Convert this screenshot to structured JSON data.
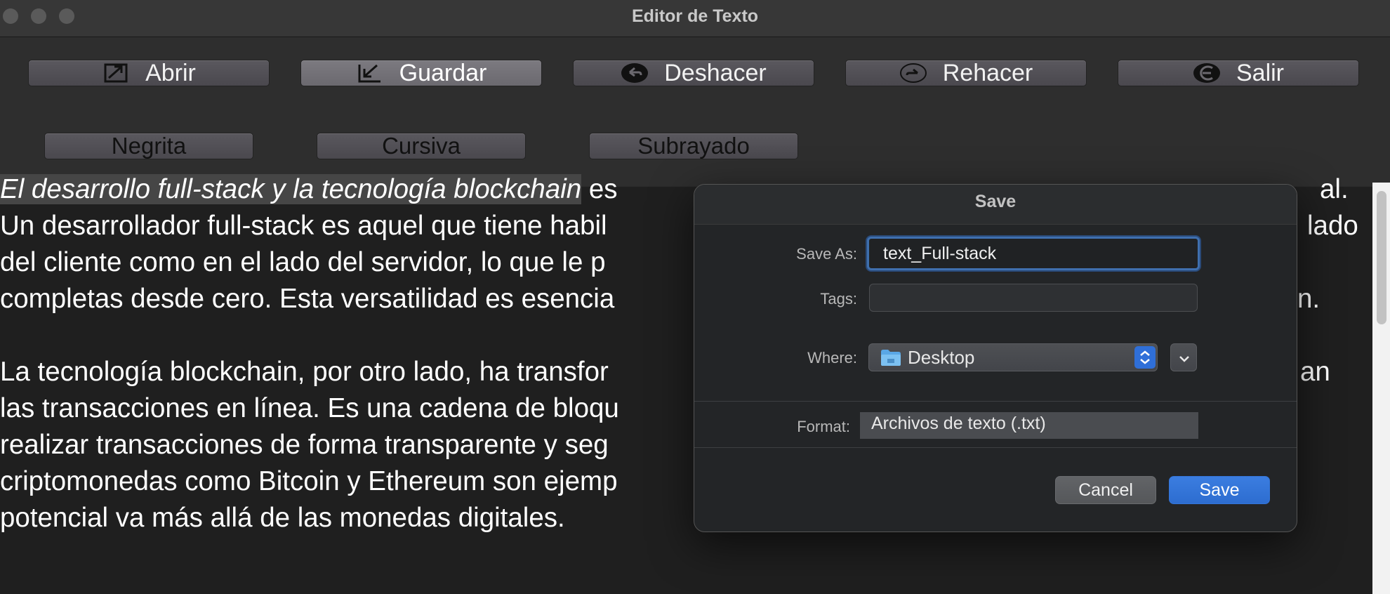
{
  "window": {
    "title": "Editor de Texto"
  },
  "toolbar": {
    "row1": [
      {
        "label": "Abrir",
        "icon": "open-external-icon"
      },
      {
        "label": "Guardar",
        "icon": "save-arrow-icon"
      },
      {
        "label": "Deshacer",
        "icon": "undo-icon"
      },
      {
        "label": "Rehacer",
        "icon": "redo-icon"
      },
      {
        "label": "Salir",
        "icon": "exit-icon"
      }
    ],
    "row2": [
      {
        "label": "Negrita"
      },
      {
        "label": "Cursiva"
      },
      {
        "label": "Subrayado"
      }
    ]
  },
  "editor": {
    "selected_text": "El desarrollo full-stack y la tecnología blockchain",
    "lines": [
      {
        "left": " es",
        "right": "al."
      },
      {
        "left": "Un desarrollador full-stack es aquel que tiene habil",
        "right": "lado"
      },
      {
        "left": "del cliente como en el lado del servidor, lo que le p",
        "right": ""
      },
      {
        "left": "completas desde cero. Esta versatilidad es esencia",
        "right": "n."
      },
      {
        "left": "",
        "right": ""
      },
      {
        "left": "La tecnología blockchain, por otro lado, ha transfor",
        "right": "an"
      },
      {
        "left": "las transacciones en línea. Es una cadena de bloqu",
        "right": ""
      },
      {
        "left": "realizar transacciones de forma transparente y seg",
        "right": ""
      },
      {
        "left": "criptomonedas como Bitcoin y Ethereum son ejemp",
        "right": ""
      },
      {
        "left": "potencial va más allá de las monedas digitales.",
        "right": ""
      }
    ]
  },
  "dialog": {
    "title": "Save",
    "save_as_label": "Save As:",
    "save_as_value": "text_Full-stack",
    "tags_label": "Tags:",
    "tags_value": "",
    "where_label": "Where:",
    "where_value": "Desktop",
    "format_label": "Format:",
    "format_value": "Archivos de texto (.txt)",
    "cancel_label": "Cancel",
    "save_label": "Save",
    "colors": {
      "primary": "#2f71d6",
      "focus_ring": "#3f6fae"
    }
  }
}
